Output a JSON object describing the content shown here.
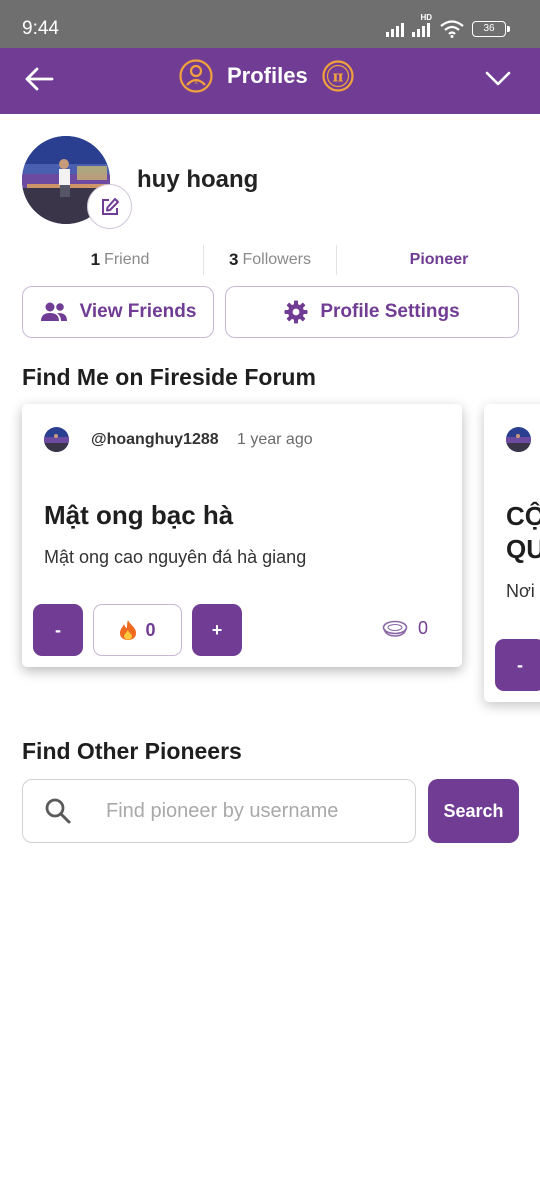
{
  "status_bar": {
    "time": "9:44",
    "battery": "36",
    "network": "HD"
  },
  "header": {
    "title": "Profiles"
  },
  "profile": {
    "username": "huy hoang",
    "friends_count": "1",
    "friends_label": "Friend",
    "followers_count": "3",
    "followers_label": "Followers",
    "role": "Pioneer"
  },
  "actions": {
    "view_friends": "View Friends",
    "profile_settings": "Profile Settings"
  },
  "fireside": {
    "section_title": "Find Me on Fireside Forum",
    "posts": [
      {
        "author": "@hoanghuy1288",
        "time": "1 year ago",
        "title": "Mật ong bạc hà",
        "body": "Mật ong cao nguyên đá hà giang",
        "downvote": "-",
        "fire_count": "0",
        "upvote": "+",
        "comment_count": "0"
      },
      {
        "title_line1": "CỘ",
        "title_line2": "QU",
        "body": "Nơi",
        "downvote": "-"
      }
    ]
  },
  "find_pioneers": {
    "section_title": "Find Other Pioneers",
    "placeholder": "Find pioneer by username",
    "button": "Search"
  },
  "colors": {
    "brand": "#713c93",
    "accent_gold": "#f2a23c"
  },
  "icons": [
    "back-arrow-icon",
    "profile-icon",
    "pi-coin-icon",
    "chevron-down-icon",
    "edit-icon",
    "friends-icon",
    "gear-icon",
    "fire-icon",
    "comment-icon",
    "search-icon"
  ]
}
